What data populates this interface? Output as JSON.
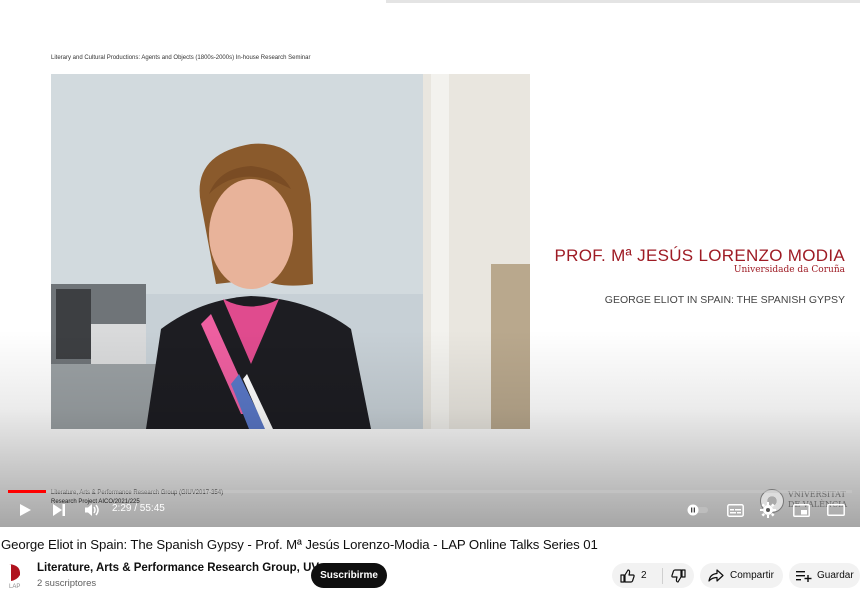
{
  "player": {
    "seminar_line": "Literary and Cultural Productions: Agents and Objects (1800s-2000s) In-house Research Seminar",
    "speaker_name": "PROF. Mª JESÚS LORENZO MODIA",
    "speaker_affiliation": "Universidade da Coruña",
    "talk_title": "GEORGE ELIOT  IN SPAIN: THE SPANISH GYPSY",
    "credit_line_1": "Literature, Arts & Performance Research Group (GIUV2017-354)",
    "credit_line_2": "Research Project AICO/2021/225",
    "university_logo_text": "VNIVERSITAT\nDE VALÈNCIA",
    "time_display": "2:29 / 55:45",
    "progress_fraction": 0.045,
    "accent_color": "#ff0000",
    "icons": [
      "play-icon",
      "next-icon",
      "volume-icon",
      "autoplay-toggle-icon",
      "subtitles-icon",
      "settings-gear-icon",
      "miniplayer-icon",
      "theater-mode-icon"
    ]
  },
  "video": {
    "title": "George Eliot in Spain: The Spanish Gypsy - Prof. Mª Jesús Lorenzo-Modia - LAP Online Talks Series 01"
  },
  "channel": {
    "name": "Literature, Arts & Performance Research Group, UV",
    "subscribers": "2 suscriptores",
    "avatar_label": "LAP",
    "subscribe_label": "Suscribirme"
  },
  "actions": {
    "like_count": "2",
    "share_label": "Compartir",
    "save_label": "Guardar"
  }
}
